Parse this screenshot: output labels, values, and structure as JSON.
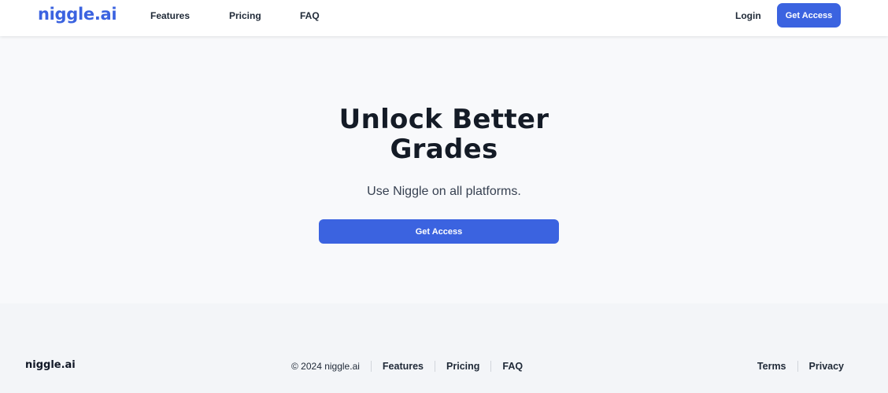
{
  "header": {
    "brand": "niggle.ai",
    "nav": {
      "features": "Features",
      "pricing": "Pricing",
      "faq": "FAQ"
    },
    "login": "Login",
    "cta": "Get Access"
  },
  "hero": {
    "title_line1": "Unlock Better",
    "title_line2": "Grades",
    "subtitle": "Use Niggle on all platforms.",
    "cta": "Get Access"
  },
  "footer": {
    "brand": "niggle.ai",
    "copyright": "© 2024 niggle.ai",
    "links": {
      "features": "Features",
      "pricing": "Pricing",
      "faq": "FAQ",
      "terms": "Terms",
      "privacy": "Privacy"
    }
  },
  "colors": {
    "accent": "#3b63e0",
    "background": "#f8f9fb",
    "text": "#111827"
  }
}
